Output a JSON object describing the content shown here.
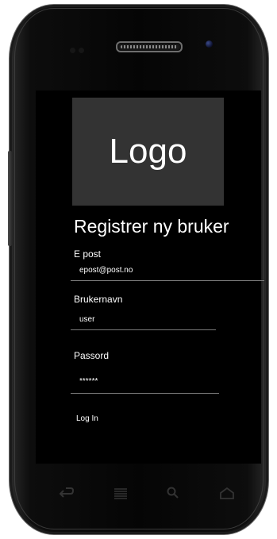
{
  "screen": {
    "logo_text": "Logo",
    "title": "Registrer ny bruker",
    "fields": [
      {
        "label": "E post",
        "value": "epost@post.no"
      },
      {
        "label": "Brukernavn",
        "value": "user"
      },
      {
        "label": "Passord",
        "value": "******"
      }
    ],
    "login_label": "Log In"
  },
  "navbar": {
    "icons": [
      "back-icon",
      "menu-icon",
      "search-icon",
      "home-icon"
    ]
  },
  "colors": {
    "screen_bg": "#000000",
    "logo_bg": "#333333",
    "text": "#ffffff",
    "underline": "#7a7a7a"
  }
}
